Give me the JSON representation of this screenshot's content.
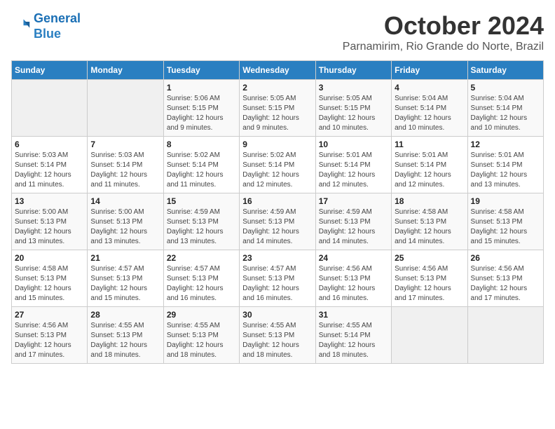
{
  "logo": {
    "line1": "General",
    "line2": "Blue"
  },
  "title": "October 2024",
  "location": "Parnamirim, Rio Grande do Norte, Brazil",
  "days_header": [
    "Sunday",
    "Monday",
    "Tuesday",
    "Wednesday",
    "Thursday",
    "Friday",
    "Saturday"
  ],
  "weeks": [
    [
      {
        "day": "",
        "info": ""
      },
      {
        "day": "",
        "info": ""
      },
      {
        "day": "1",
        "info": "Sunrise: 5:06 AM\nSunset: 5:15 PM\nDaylight: 12 hours\nand 9 minutes."
      },
      {
        "day": "2",
        "info": "Sunrise: 5:05 AM\nSunset: 5:15 PM\nDaylight: 12 hours\nand 9 minutes."
      },
      {
        "day": "3",
        "info": "Sunrise: 5:05 AM\nSunset: 5:15 PM\nDaylight: 12 hours\nand 10 minutes."
      },
      {
        "day": "4",
        "info": "Sunrise: 5:04 AM\nSunset: 5:14 PM\nDaylight: 12 hours\nand 10 minutes."
      },
      {
        "day": "5",
        "info": "Sunrise: 5:04 AM\nSunset: 5:14 PM\nDaylight: 12 hours\nand 10 minutes."
      }
    ],
    [
      {
        "day": "6",
        "info": "Sunrise: 5:03 AM\nSunset: 5:14 PM\nDaylight: 12 hours\nand 11 minutes."
      },
      {
        "day": "7",
        "info": "Sunrise: 5:03 AM\nSunset: 5:14 PM\nDaylight: 12 hours\nand 11 minutes."
      },
      {
        "day": "8",
        "info": "Sunrise: 5:02 AM\nSunset: 5:14 PM\nDaylight: 12 hours\nand 11 minutes."
      },
      {
        "day": "9",
        "info": "Sunrise: 5:02 AM\nSunset: 5:14 PM\nDaylight: 12 hours\nand 12 minutes."
      },
      {
        "day": "10",
        "info": "Sunrise: 5:01 AM\nSunset: 5:14 PM\nDaylight: 12 hours\nand 12 minutes."
      },
      {
        "day": "11",
        "info": "Sunrise: 5:01 AM\nSunset: 5:14 PM\nDaylight: 12 hours\nand 12 minutes."
      },
      {
        "day": "12",
        "info": "Sunrise: 5:01 AM\nSunset: 5:14 PM\nDaylight: 12 hours\nand 13 minutes."
      }
    ],
    [
      {
        "day": "13",
        "info": "Sunrise: 5:00 AM\nSunset: 5:13 PM\nDaylight: 12 hours\nand 13 minutes."
      },
      {
        "day": "14",
        "info": "Sunrise: 5:00 AM\nSunset: 5:13 PM\nDaylight: 12 hours\nand 13 minutes."
      },
      {
        "day": "15",
        "info": "Sunrise: 4:59 AM\nSunset: 5:13 PM\nDaylight: 12 hours\nand 13 minutes."
      },
      {
        "day": "16",
        "info": "Sunrise: 4:59 AM\nSunset: 5:13 PM\nDaylight: 12 hours\nand 14 minutes."
      },
      {
        "day": "17",
        "info": "Sunrise: 4:59 AM\nSunset: 5:13 PM\nDaylight: 12 hours\nand 14 minutes."
      },
      {
        "day": "18",
        "info": "Sunrise: 4:58 AM\nSunset: 5:13 PM\nDaylight: 12 hours\nand 14 minutes."
      },
      {
        "day": "19",
        "info": "Sunrise: 4:58 AM\nSunset: 5:13 PM\nDaylight: 12 hours\nand 15 minutes."
      }
    ],
    [
      {
        "day": "20",
        "info": "Sunrise: 4:58 AM\nSunset: 5:13 PM\nDaylight: 12 hours\nand 15 minutes."
      },
      {
        "day": "21",
        "info": "Sunrise: 4:57 AM\nSunset: 5:13 PM\nDaylight: 12 hours\nand 15 minutes."
      },
      {
        "day": "22",
        "info": "Sunrise: 4:57 AM\nSunset: 5:13 PM\nDaylight: 12 hours\nand 16 minutes."
      },
      {
        "day": "23",
        "info": "Sunrise: 4:57 AM\nSunset: 5:13 PM\nDaylight: 12 hours\nand 16 minutes."
      },
      {
        "day": "24",
        "info": "Sunrise: 4:56 AM\nSunset: 5:13 PM\nDaylight: 12 hours\nand 16 minutes."
      },
      {
        "day": "25",
        "info": "Sunrise: 4:56 AM\nSunset: 5:13 PM\nDaylight: 12 hours\nand 17 minutes."
      },
      {
        "day": "26",
        "info": "Sunrise: 4:56 AM\nSunset: 5:13 PM\nDaylight: 12 hours\nand 17 minutes."
      }
    ],
    [
      {
        "day": "27",
        "info": "Sunrise: 4:56 AM\nSunset: 5:13 PM\nDaylight: 12 hours\nand 17 minutes."
      },
      {
        "day": "28",
        "info": "Sunrise: 4:55 AM\nSunset: 5:13 PM\nDaylight: 12 hours\nand 18 minutes."
      },
      {
        "day": "29",
        "info": "Sunrise: 4:55 AM\nSunset: 5:13 PM\nDaylight: 12 hours\nand 18 minutes."
      },
      {
        "day": "30",
        "info": "Sunrise: 4:55 AM\nSunset: 5:13 PM\nDaylight: 12 hours\nand 18 minutes."
      },
      {
        "day": "31",
        "info": "Sunrise: 4:55 AM\nSunset: 5:14 PM\nDaylight: 12 hours\nand 18 minutes."
      },
      {
        "day": "",
        "info": ""
      },
      {
        "day": "",
        "info": ""
      }
    ]
  ]
}
